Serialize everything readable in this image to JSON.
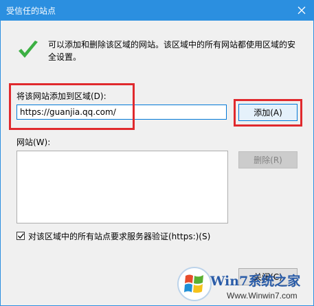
{
  "window": {
    "title": "受信任的站点",
    "close_icon": "close-icon",
    "accent_color": "#2b8fe0"
  },
  "info": {
    "icon": "checkmark-icon",
    "text": "可以添加和删除该区域的网站。该区域中的所有网站都使用区域的安全设置。"
  },
  "add_site": {
    "label": "将该网站添加到区域(D):",
    "value": "https://guanjia.qq.com/",
    "add_button": "添加(A)"
  },
  "sites": {
    "label": "网站(W):",
    "items": [],
    "remove_button": "删除(R)"
  },
  "https_option": {
    "label": "对该区域中的所有站点要求服务器验证(https:)(S)",
    "checked": true
  },
  "footer": {
    "close_button": "关闭(C)"
  },
  "watermark": {
    "brand_top": "Win7系统之家",
    "brand_bottom": "Www.Winwin7.com"
  },
  "highlight_color": "#e0292d"
}
